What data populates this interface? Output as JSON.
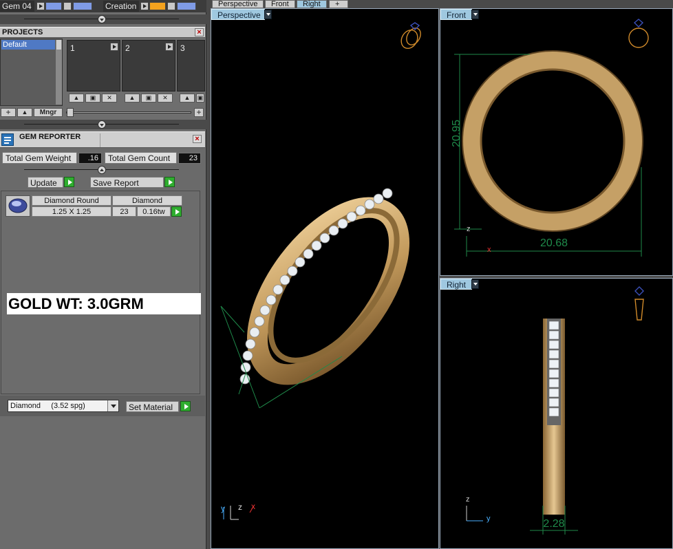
{
  "toolbar": {
    "gem_label": "Gem 04",
    "creation_label": "Creation"
  },
  "projects": {
    "title": "PROJECTS",
    "list": [
      "Default"
    ],
    "slots": [
      "1",
      "2",
      "3"
    ],
    "mngr_label": "Mngr"
  },
  "gem_reporter": {
    "title": "GEM REPORTER",
    "total_weight_label": "Total Gem Weight",
    "total_weight_value": ".16",
    "total_count_label": "Total Gem Count",
    "total_count_value": "23",
    "update_label": "Update",
    "save_report_label": "Save Report",
    "table": {
      "name": "Diamond Round",
      "size": "1.25 X 1.25",
      "material": "Diamond",
      "count": "23",
      "weight": "0.16tw"
    },
    "gold_weight": "GOLD WT: 3.0GRM",
    "material_select": "Diamond     (3.52 spg)",
    "set_material_label": "Set Material"
  },
  "viewports": {
    "tabs": [
      "Perspective",
      "Front",
      "Right",
      "+"
    ],
    "perspective": {
      "label": "Perspective",
      "axes": [
        "y",
        "z",
        "x"
      ]
    },
    "front": {
      "label": "Front",
      "dim_vertical": "20.95",
      "dim_horizontal": "20.68",
      "axis_z": "z",
      "axis_x": "x"
    },
    "right": {
      "label": "Right",
      "dim_width": "2.28",
      "axis_z": "z",
      "axis_y": "y"
    }
  },
  "colors": {
    "gold": "#c9a36a",
    "gold_dark": "#7a5a30",
    "dim_green": "#1f8a4a",
    "viewport_tag": "#9fc8e0"
  }
}
